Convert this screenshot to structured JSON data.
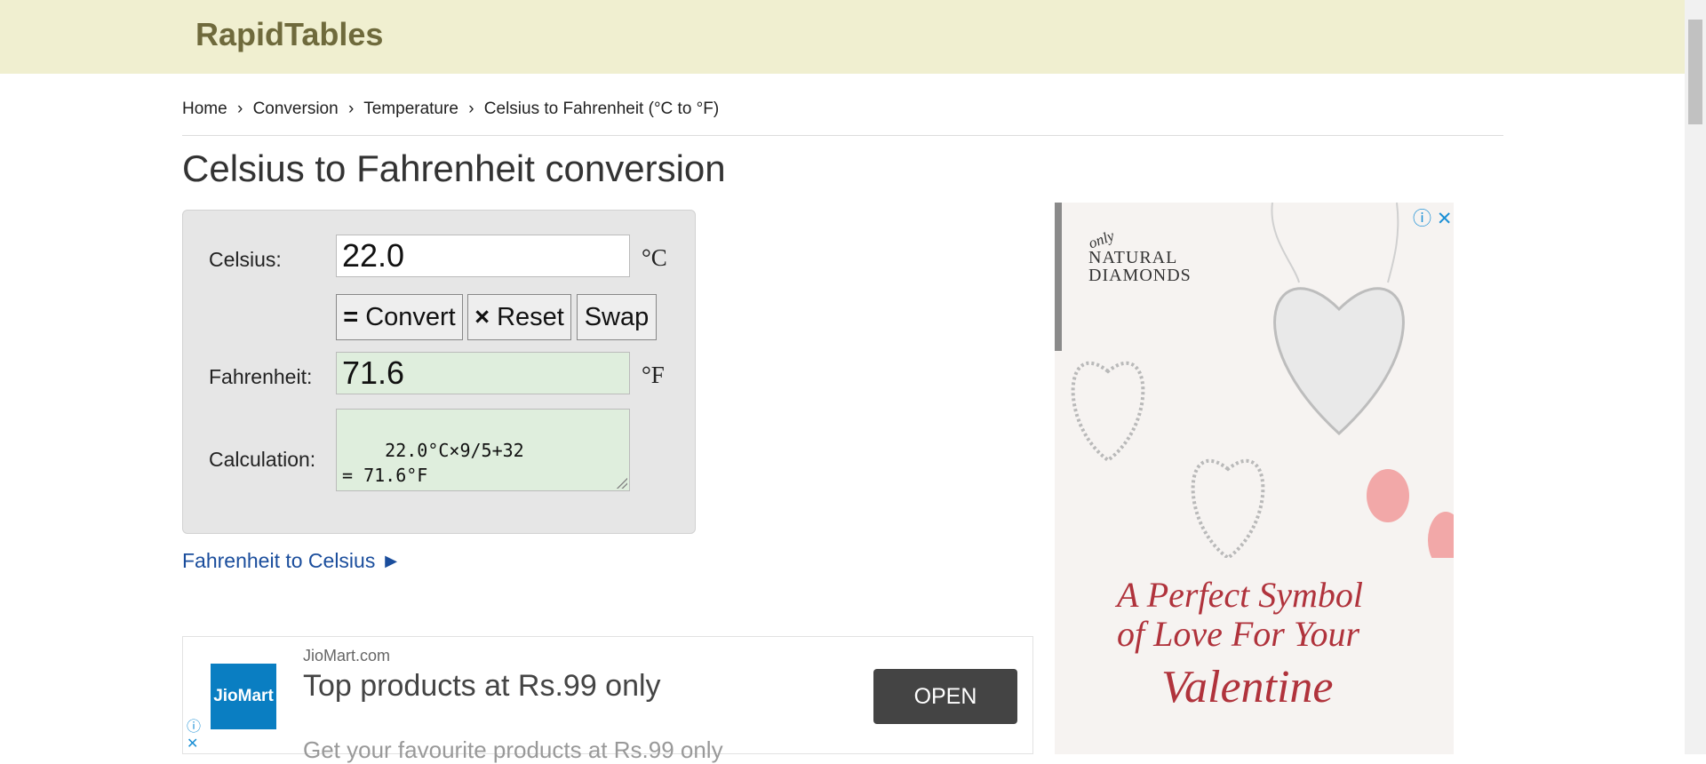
{
  "header": {
    "logo": "RapidTables"
  },
  "breadcrumb": {
    "items": [
      "Home",
      "Conversion",
      "Temperature",
      "Celsius to Fahrenheit (°C to °F)"
    ],
    "separator": "›"
  },
  "page": {
    "title": "Celsius to Fahrenheit conversion"
  },
  "converter": {
    "celsius_label": "Celsius:",
    "celsius_value": "22.0",
    "celsius_unit": "°C",
    "convert_label": "Convert",
    "convert_symbol": "=",
    "reset_label": "Reset",
    "reset_symbol": "×",
    "swap_label": "Swap",
    "fahrenheit_label": "Fahrenheit:",
    "fahrenheit_value": "71.6",
    "fahrenheit_unit": "°F",
    "calculation_label": "Calculation:",
    "calculation_value": "22.0°C×9/5+32\n= 71.6°F"
  },
  "reverse_link": {
    "label": "Fahrenheit to Celsius ►"
  },
  "ad_bottom": {
    "logo_text": "JioMart",
    "domain": "JioMart.com",
    "headline": "Top products at Rs.99 only",
    "subtext": "Get your favourite products at Rs.99 only",
    "cta": "OPEN",
    "info_icon": "ⓘ",
    "close_icon": "✕"
  },
  "ad_side": {
    "brand_only": "only",
    "brand_line1": "NATURAL",
    "brand_line2": "DIAMONDS",
    "tagline_line1": "A Perfect Symbol",
    "tagline_line2": "of Love For Your",
    "tagline_line3": "Valentine",
    "info_icon": "ⓘ",
    "close_icon": "✕"
  },
  "colors": {
    "header_bg": "#f0efd0",
    "logo": "#6f6a3c",
    "result_bg": "#dfeedd",
    "link": "#1a4d9c"
  }
}
